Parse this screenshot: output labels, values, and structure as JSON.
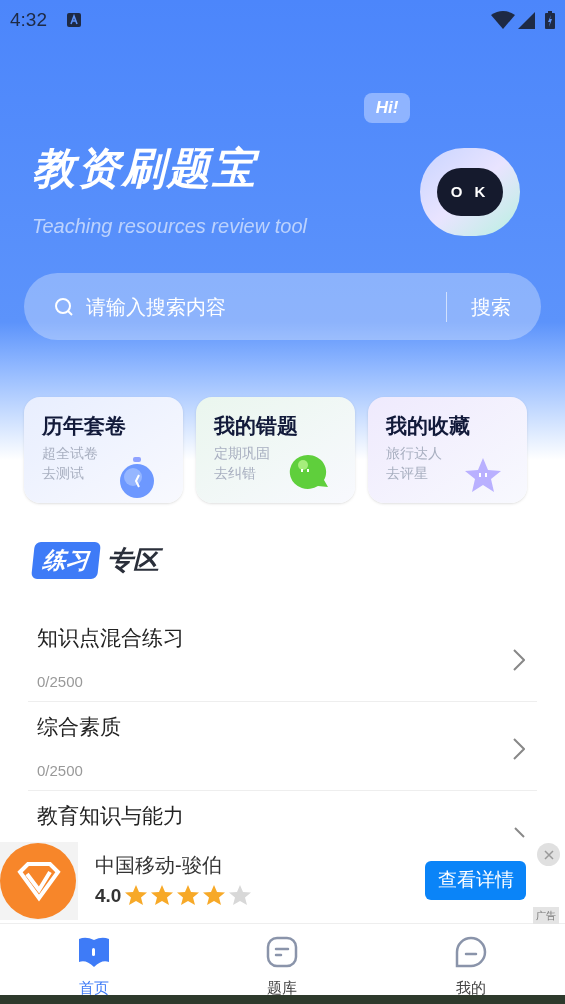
{
  "status_bar": {
    "time": "4:32"
  },
  "header": {
    "title": "教资刷题宝",
    "subtitle": "Teaching resources review tool",
    "bubble": "Hi!",
    "mascot_face": "O K"
  },
  "search": {
    "placeholder": "请输入搜索内容",
    "button": "搜索"
  },
  "cards": [
    {
      "title": "历年套卷",
      "line_1": "超全试卷",
      "line_2": "去测试",
      "kind": "clock"
    },
    {
      "title": "我的错题",
      "line_1": "定期巩固",
      "line_2": "去纠错",
      "kind": "bubble"
    },
    {
      "title": "我的收藏",
      "line_1": "旅行达人",
      "line_2": "去评星",
      "kind": "star"
    }
  ],
  "section": {
    "badge": "练习",
    "title": "专区"
  },
  "practice": [
    {
      "title": "知识点混合练习",
      "progress": "0/2500"
    },
    {
      "title": "综合素质",
      "progress": "0/2500"
    },
    {
      "title": "教育知识与能力"
    }
  ],
  "ad": {
    "name": "中国移动-骏伯",
    "rating": "4.0",
    "stars": 4,
    "button": "查看详情",
    "tag": "广告"
  },
  "tabs": [
    {
      "label": "首页",
      "selected": true,
      "kind": "home"
    },
    {
      "label": "题库",
      "selected": false,
      "kind": "bank"
    },
    {
      "label": "我的",
      "selected": false,
      "kind": "me"
    }
  ]
}
